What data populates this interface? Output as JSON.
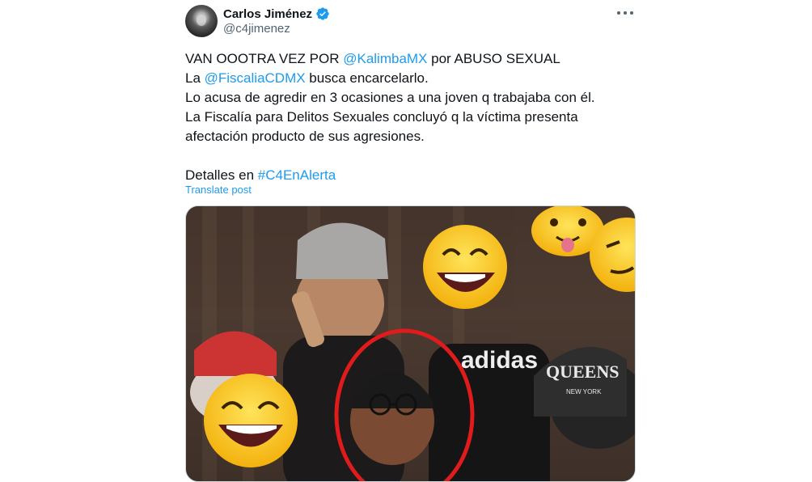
{
  "author": {
    "display_name": "Carlos Jiménez",
    "handle": "@c4jimenez",
    "verified_color": "#1d9bf0"
  },
  "tweet": {
    "line1": {
      "pre": "VAN OOOTRA VEZ POR ",
      "mention": "@KalimbaMX",
      "post": " por ABUSO SEXUAL"
    },
    "line2": {
      "pre": "La ",
      "mention": "@FiscaliaCDMX",
      "post": " busca encarcelarlo."
    },
    "line3": "Lo acusa de agredir en 3 ocasiones a una joven q trabajaba con él.",
    "line4": "La Fiscalía para Delitos Sexuales concluyó q la víctima presenta",
    "line5": "afectación producto de sus agresiones.",
    "line6": {
      "pre": "Detalles en ",
      "hashtag": "#C4EnAlerta"
    },
    "translate_label": "Translate post"
  },
  "media": {
    "cap_text": "QUEENS",
    "cap_subtext": "NEW YORK",
    "shirt_text": "adidas",
    "highlight_color": "#e01b1b"
  },
  "icons": {
    "more": "more-options-icon",
    "verified": "verified-badge-icon"
  },
  "colors": {
    "link": "#1d9bf0",
    "text": "#0f1419",
    "secondary": "#536471"
  }
}
